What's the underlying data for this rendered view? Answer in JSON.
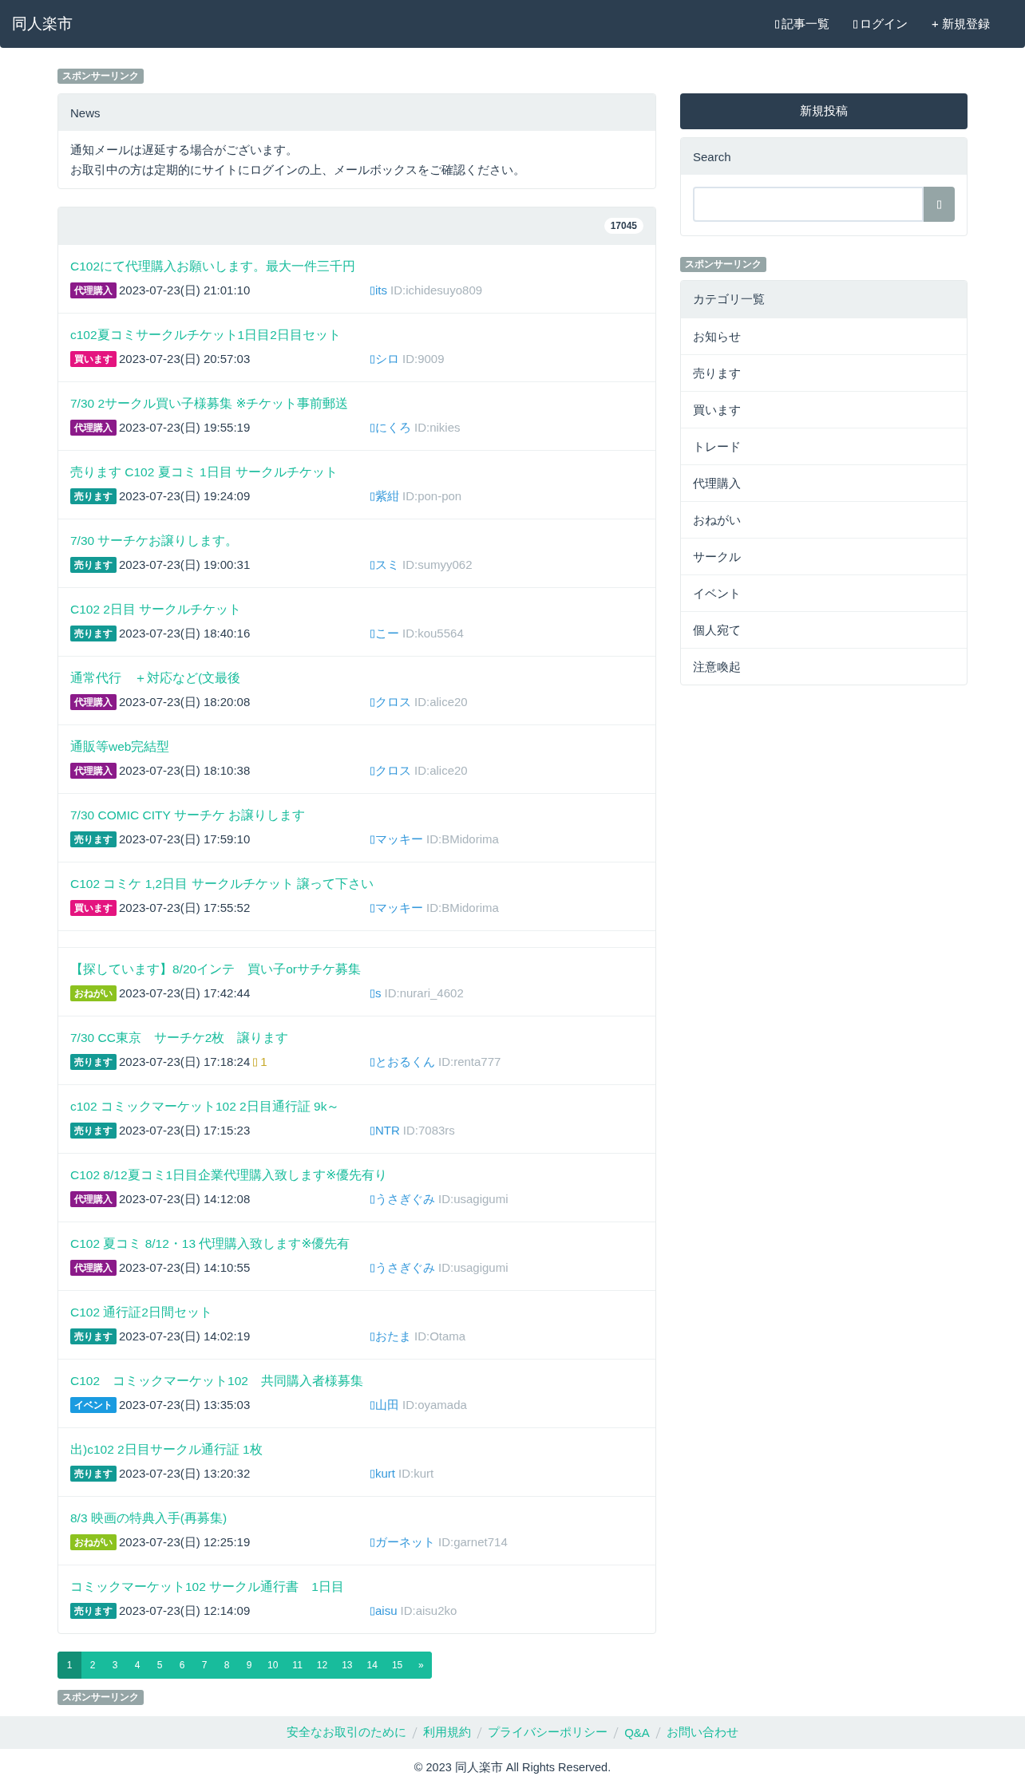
{
  "navbar": {
    "brand": "同人楽市",
    "links": [
      {
        "label": "記事一覧",
        "icon": true
      },
      {
        "label": "ログイン",
        "icon": true
      },
      {
        "label": "+ 新規登録",
        "icon": false
      }
    ]
  },
  "main": {
    "sponsor_top": "スポンサーリンク",
    "news": {
      "title": "News",
      "lines": [
        "通知メールは遅延する場合がございます。",
        "お取引中の方は定期的にサイトにログインの上、メールボックスをご確認ください。"
      ]
    },
    "post_count": "17045",
    "posts": [
      {
        "kind": "post",
        "title": "C102にて代理購入お願いします。最大一件三千円",
        "tag": {
          "label": "代理購入",
          "color": "#8b1a89"
        },
        "date": "2023-07-23(日) 21:01:10",
        "author": "its",
        "user_id": "ID:ichidesuyo809"
      },
      {
        "kind": "post",
        "title": "c102夏コミサークルチケット1日目2日目セット",
        "tag": {
          "label": "買います",
          "color": "#e4147f"
        },
        "date": "2023-07-23(日) 20:57:03",
        "author": "シロ",
        "user_id": "ID:9009"
      },
      {
        "kind": "post",
        "title": "7/30 2サークル買い子様募集 ※チケット事前郵送",
        "tag": {
          "label": "代理購入",
          "color": "#8b1a89"
        },
        "date": "2023-07-23(日) 19:55:19",
        "author": "にくろ",
        "user_id": "ID:nikies"
      },
      {
        "kind": "post",
        "title": "売ります C102 夏コミ 1日目 サークルチケット",
        "tag": {
          "label": "売ります",
          "color": "#139a94"
        },
        "date": "2023-07-23(日) 19:24:09",
        "author": "紫紺",
        "user_id": "ID:pon-pon"
      },
      {
        "kind": "post",
        "title": "7/30 サーチケお譲りします。",
        "tag": {
          "label": "売ります",
          "color": "#139a94"
        },
        "date": "2023-07-23(日) 19:00:31",
        "author": "スミ",
        "user_id": "ID:sumyy062"
      },
      {
        "kind": "post",
        "title": "C102 2日目 サークルチケット",
        "tag": {
          "label": "売ります",
          "color": "#139a94"
        },
        "date": "2023-07-23(日) 18:40:16",
        "author": "こー",
        "user_id": "ID:kou5564"
      },
      {
        "kind": "post",
        "title": "通常代行　＋対応など(文最後",
        "tag": {
          "label": "代理購入",
          "color": "#8b1a89"
        },
        "date": "2023-07-23(日) 18:20:08",
        "author": "クロス",
        "user_id": "ID:alice20"
      },
      {
        "kind": "post",
        "title": "通販等web完結型",
        "tag": {
          "label": "代理購入",
          "color": "#8b1a89"
        },
        "date": "2023-07-23(日) 18:10:38",
        "author": "クロス",
        "user_id": "ID:alice20"
      },
      {
        "kind": "post",
        "title": "7/30 COMIC CITY サーチケ お譲りします",
        "tag": {
          "label": "売ります",
          "color": "#139a94"
        },
        "date": "2023-07-23(日) 17:59:10",
        "author": "マッキー",
        "user_id": "ID:BMidorima"
      },
      {
        "kind": "post",
        "title": "C102 コミケ 1,2日目 サークルチケット 譲って下さい",
        "tag": {
          "label": "買います",
          "color": "#e4147f"
        },
        "date": "2023-07-23(日) 17:55:52",
        "author": "マッキー",
        "user_id": "ID:BMidorima"
      },
      {
        "kind": "blank"
      },
      {
        "kind": "post",
        "title": "【探しています】8/20インテ　買い子orサチケ募集",
        "tag": {
          "label": "おねがい",
          "color": "#8cc21f"
        },
        "date": "2023-07-23(日) 17:42:44",
        "author": "s",
        "user_id": "ID:nurari_4602"
      },
      {
        "kind": "post",
        "title": "7/30 CC東京　サーチケ2枚　譲ります",
        "tag": {
          "label": "売ります",
          "color": "#139a94"
        },
        "date": "2023-07-23(日) 17:18:24",
        "count": "1",
        "author": "とおるくん",
        "user_id": "ID:renta777"
      },
      {
        "kind": "post",
        "title": "c102 コミックマーケット102 2日目通行証 9k～",
        "tag": {
          "label": "売ります",
          "color": "#139a94"
        },
        "date": "2023-07-23(日) 17:15:23",
        "author": "NTR",
        "user_id": "ID:7083rs"
      },
      {
        "kind": "post",
        "title": "C102 8/12夏コミ1日目企業代理購入致します※優先有り",
        "tag": {
          "label": "代理購入",
          "color": "#8b1a89"
        },
        "date": "2023-07-23(日) 14:12:08",
        "author": "うさぎぐみ",
        "user_id": "ID:usagigumi"
      },
      {
        "kind": "post",
        "title": "C102 夏コミ 8/12・13 代理購入致します※優先有",
        "tag": {
          "label": "代理購入",
          "color": "#8b1a89"
        },
        "date": "2023-07-23(日) 14:10:55",
        "author": "うさぎぐみ",
        "user_id": "ID:usagigumi"
      },
      {
        "kind": "post",
        "title": "C102 通行証2日間セット",
        "tag": {
          "label": "売ります",
          "color": "#139a94"
        },
        "date": "2023-07-23(日) 14:02:19",
        "author": "おたま",
        "user_id": "ID:Otama"
      },
      {
        "kind": "post",
        "title": "C102　コミックマーケット102　共同購入者様募集",
        "tag": {
          "label": "イベント",
          "color": "#1a9be0"
        },
        "date": "2023-07-23(日) 13:35:03",
        "author": "山田",
        "user_id": "ID:oyamada"
      },
      {
        "kind": "post",
        "title": "出)c102 2日目サークル通行証 1枚",
        "tag": {
          "label": "売ります",
          "color": "#139a94"
        },
        "date": "2023-07-23(日) 13:20:32",
        "author": "kurt",
        "user_id": "ID:kurt"
      },
      {
        "kind": "post",
        "title": "8/3 映画の特典入手(再募集)",
        "tag": {
          "label": "おねがい",
          "color": "#8cc21f"
        },
        "date": "2023-07-23(日) 12:25:19",
        "author": "ガーネット",
        "user_id": "ID:garnet714"
      },
      {
        "kind": "post",
        "title": "コミックマーケット102 サークル通行書　1日目",
        "tag": {
          "label": "売ります",
          "color": "#139a94"
        },
        "date": "2023-07-23(日) 12:14:09",
        "author": "aisu",
        "user_id": "ID:aisu2ko"
      }
    ],
    "pagination": [
      {
        "label": "1",
        "selected": true
      },
      {
        "label": "2",
        "selected": false
      },
      {
        "label": "3",
        "selected": false
      },
      {
        "label": "4",
        "selected": false
      },
      {
        "label": "5",
        "selected": false
      },
      {
        "label": "6",
        "selected": false
      },
      {
        "label": "7",
        "selected": false
      },
      {
        "label": "8",
        "selected": false
      },
      {
        "label": "9",
        "selected": false
      },
      {
        "label": "10",
        "selected": false
      },
      {
        "label": "11",
        "selected": false
      },
      {
        "label": "12",
        "selected": false
      },
      {
        "label": "13",
        "selected": false
      },
      {
        "label": "14",
        "selected": false
      },
      {
        "label": "15",
        "selected": false
      },
      {
        "label": "»",
        "selected": false
      }
    ],
    "sponsor_bottom": "スポンサーリンク"
  },
  "sidebar": {
    "new_post_button": "新規投稿",
    "search": {
      "title": "Search"
    },
    "sponsor": "スポンサーリンク",
    "categories": {
      "title": "カテゴリ一覧",
      "items": [
        "お知らせ",
        "売ります",
        "買います",
        "トレード",
        "代理購入",
        "おねがい",
        "サークル",
        "イベント",
        "個人宛て",
        "注意喚起"
      ]
    }
  },
  "footer": {
    "links": [
      "安全なお取引のために",
      "利用規約",
      "プライバシーポリシー",
      "Q&A",
      "お問い合わせ"
    ],
    "copyright": "© 2023 同人楽市 All Rights Reserved."
  }
}
